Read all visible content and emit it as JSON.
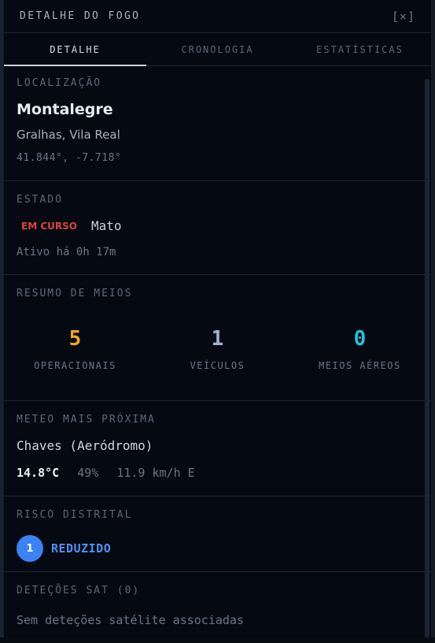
{
  "header": {
    "title": "DETALHE DO FOGO",
    "close_label": "[×]"
  },
  "tabs": [
    {
      "label": "DETALHE",
      "active": true
    },
    {
      "label": "CRONOLOGIA",
      "active": false
    },
    {
      "label": "ESTATÍSTICAS",
      "active": false
    }
  ],
  "location": {
    "section_label": "LOCALIZAÇÃO",
    "name": "Montalegre",
    "sub": "Gralhas, Vila Real",
    "coords": "41.844°, -7.718°"
  },
  "estado": {
    "section_label": "ESTADO",
    "status": "EM CURSO",
    "status_color": "#e0433c",
    "type": "Mato",
    "active_time": "Ativo há 0h 17m"
  },
  "meios": {
    "section_label": "RESUMO DE MEIOS",
    "items": [
      {
        "value": "5",
        "label": "OPERACIONAIS",
        "color": "#f5a623"
      },
      {
        "value": "1",
        "label": "VEÍCULOS",
        "color": "#9fb3d0"
      },
      {
        "value": "0",
        "label": "MEIOS AÉREOS",
        "color": "#22c4d8"
      }
    ]
  },
  "meteo": {
    "section_label": "METEO MAIS PRÓXIMA",
    "station": "Chaves (Aeródromo)",
    "temp": "14.8°C",
    "humidity": "49%",
    "wind": "11.9 km/h E"
  },
  "risco": {
    "section_label": "RISCO DISTRITAL",
    "level": "1",
    "label": "REDUZIDO",
    "color": "#3b82f6"
  },
  "sat": {
    "section_label": "DETEÇÕES SAT (0)",
    "empty_text": "Sem deteções satélite associadas"
  }
}
